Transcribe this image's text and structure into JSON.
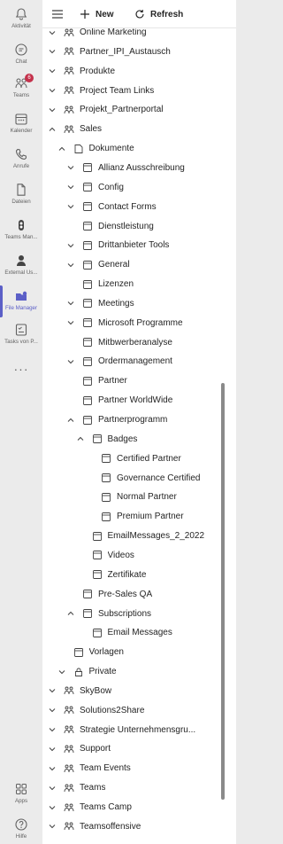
{
  "rail": {
    "items": [
      {
        "label": "Aktivität",
        "icon": "bell-icon"
      },
      {
        "label": "Chat",
        "icon": "chat-icon"
      },
      {
        "label": "Teams",
        "icon": "teams-icon",
        "badge": "6"
      },
      {
        "label": "Kalender",
        "icon": "calendar-icon"
      },
      {
        "label": "Anrufe",
        "icon": "phone-icon"
      },
      {
        "label": "Dateien",
        "icon": "file-icon"
      },
      {
        "label": "Teams Man...",
        "icon": "teams-manager-icon"
      },
      {
        "label": "External Us...",
        "icon": "external-user-icon"
      },
      {
        "label": "File Manager",
        "icon": "file-manager-icon",
        "active": true
      },
      {
        "label": "Tasks von P...",
        "icon": "tasks-icon"
      },
      {
        "label": "Apps",
        "icon": "apps-icon"
      },
      {
        "label": "Hilfe",
        "icon": "help-icon"
      }
    ],
    "more": "···",
    "accent_color": "#5b5fc7",
    "badge_color": "#c4314b"
  },
  "toolbar": {
    "new_label": "New",
    "refresh_label": "Refresh"
  },
  "tree": [
    {
      "label": "Online Marketing",
      "level": 0,
      "type": "team",
      "chevron": "down"
    },
    {
      "label": "Partner_IPI_Austausch",
      "level": 0,
      "type": "team",
      "chevron": "down"
    },
    {
      "label": "Produkte",
      "level": 0,
      "type": "team",
      "chevron": "down"
    },
    {
      "label": "Project Team Links",
      "level": 0,
      "type": "team",
      "chevron": "down"
    },
    {
      "label": "Projekt_Partnerportal",
      "level": 0,
      "type": "team",
      "chevron": "down"
    },
    {
      "label": "Sales",
      "level": 0,
      "type": "team",
      "chevron": "up"
    },
    {
      "label": "Dokumente",
      "level": 1,
      "type": "library",
      "chevron": "up"
    },
    {
      "label": "Allianz Ausschreibung",
      "level": 2,
      "type": "folder",
      "chevron": "down"
    },
    {
      "label": "Config",
      "level": 2,
      "type": "folder",
      "chevron": "down"
    },
    {
      "label": "Contact Forms",
      "level": 2,
      "type": "folder",
      "chevron": "down"
    },
    {
      "label": "Dienstleistung",
      "level": 2,
      "type": "folder",
      "chevron": "none"
    },
    {
      "label": "Drittanbieter Tools",
      "level": 2,
      "type": "folder",
      "chevron": "down"
    },
    {
      "label": "General",
      "level": 2,
      "type": "folder",
      "chevron": "down"
    },
    {
      "label": "Lizenzen",
      "level": 2,
      "type": "folder",
      "chevron": "none"
    },
    {
      "label": "Meetings",
      "level": 2,
      "type": "folder",
      "chevron": "down"
    },
    {
      "label": "Microsoft Programme",
      "level": 2,
      "type": "folder",
      "chevron": "down"
    },
    {
      "label": "Mitbwerberanalyse",
      "level": 2,
      "type": "folder",
      "chevron": "none"
    },
    {
      "label": "Ordermanagement",
      "level": 2,
      "type": "folder",
      "chevron": "down"
    },
    {
      "label": "Partner",
      "level": 2,
      "type": "folder",
      "chevron": "none"
    },
    {
      "label": "Partner WorldWide",
      "level": 2,
      "type": "folder",
      "chevron": "none"
    },
    {
      "label": "Partnerprogramm",
      "level": 2,
      "type": "folder",
      "chevron": "up"
    },
    {
      "label": "Badges",
      "level": 3,
      "type": "folder",
      "chevron": "up"
    },
    {
      "label": "Certified Partner",
      "level": 4,
      "type": "folder",
      "chevron": "none"
    },
    {
      "label": "Governance Certified",
      "level": 4,
      "type": "folder",
      "chevron": "none"
    },
    {
      "label": "Normal Partner",
      "level": 4,
      "type": "folder",
      "chevron": "none"
    },
    {
      "label": "Premium Partner",
      "level": 4,
      "type": "folder",
      "chevron": "none"
    },
    {
      "label": "EmailMessages_2_2022",
      "level": 3,
      "type": "folder",
      "chevron": "none"
    },
    {
      "label": "Videos",
      "level": 3,
      "type": "folder",
      "chevron": "none"
    },
    {
      "label": "Zertifikate",
      "level": 3,
      "type": "folder",
      "chevron": "none"
    },
    {
      "label": "Pre-Sales QA",
      "level": 2,
      "type": "folder",
      "chevron": "none"
    },
    {
      "label": "Subscriptions",
      "level": 2,
      "type": "folder",
      "chevron": "up"
    },
    {
      "label": "Email Messages",
      "level": 3,
      "type": "folder",
      "chevron": "none"
    },
    {
      "label": "Vorlagen",
      "level": 1,
      "type": "folder",
      "chevron": "none"
    },
    {
      "label": "Private",
      "level": 1,
      "type": "lock",
      "chevron": "down"
    },
    {
      "label": "SkyBow",
      "level": 0,
      "type": "team",
      "chevron": "down"
    },
    {
      "label": "Solutions2Share",
      "level": 0,
      "type": "team",
      "chevron": "down"
    },
    {
      "label": "Strategie Unternehmensgru...",
      "level": 0,
      "type": "team",
      "chevron": "down"
    },
    {
      "label": "Support",
      "level": 0,
      "type": "team",
      "chevron": "down"
    },
    {
      "label": "Team Events",
      "level": 0,
      "type": "team",
      "chevron": "down"
    },
    {
      "label": "Teams",
      "level": 0,
      "type": "team",
      "chevron": "down"
    },
    {
      "label": "Teams Camp",
      "level": 0,
      "type": "team",
      "chevron": "down"
    },
    {
      "label": "Teamsoffensive",
      "level": 0,
      "type": "team",
      "chevron": "down"
    }
  ]
}
